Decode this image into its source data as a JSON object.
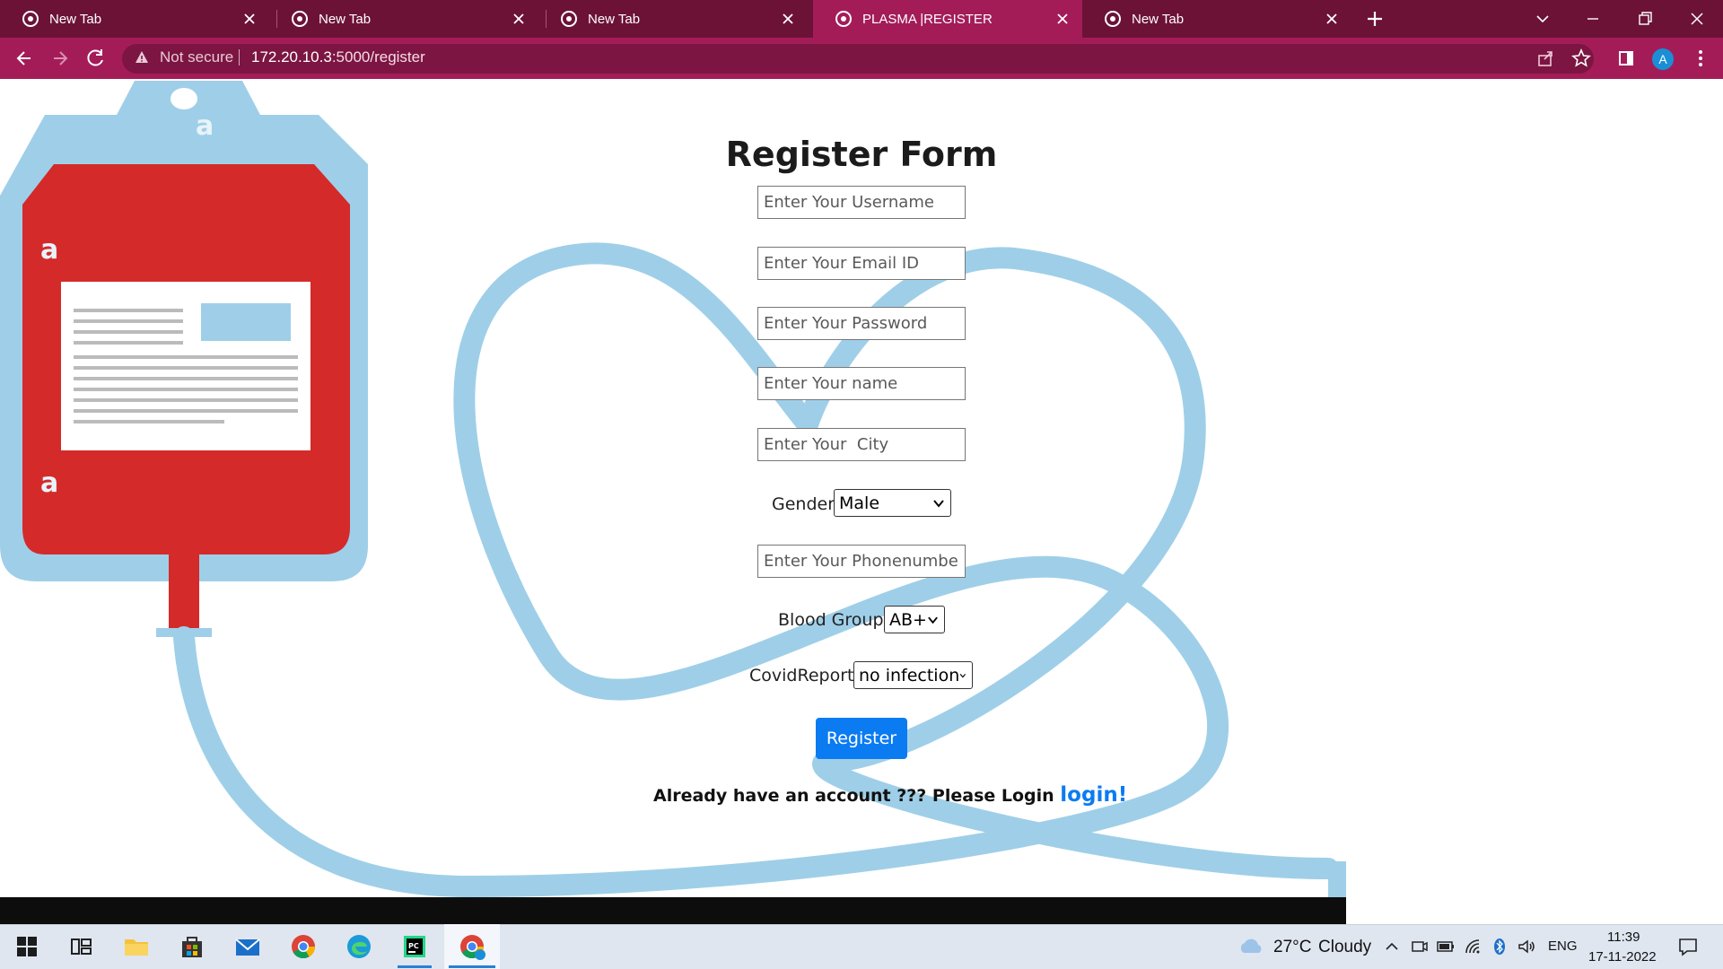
{
  "browser": {
    "tabs": [
      {
        "label": "New Tab",
        "favicon": "chrome-icon",
        "active": false
      },
      {
        "label": "New Tab",
        "favicon": "chrome-icon",
        "active": false
      },
      {
        "label": "New Tab",
        "favicon": "chrome-icon",
        "active": false
      },
      {
        "label": "PLASMA |REGISTER",
        "favicon": "globe-icon",
        "active": true
      },
      {
        "label": "New Tab",
        "favicon": "chrome-icon",
        "active": false
      }
    ],
    "security_label": "Not secure",
    "url_host": "172.20.10.3",
    "url_rest": ":5000/register",
    "profile_initial": "A",
    "theme": {
      "tabstrip": "#6c1237",
      "toolbar": "#a31c58",
      "omnibox": "#7c1542"
    }
  },
  "form": {
    "title": "Register Form",
    "username_placeholder": "Enter Your Username",
    "email_placeholder": "Enter Your Email ID",
    "password_placeholder": "Enter Your Password",
    "name_placeholder": "Enter Your name",
    "city_placeholder": "Enter Your  City",
    "gender_label": "Gender",
    "gender_value": "Male",
    "phone_placeholder": "Enter Your Phonenumber",
    "blood_group_label": "Blood Group",
    "blood_group_value": "AB+",
    "covid_label": "CovidReport",
    "covid_value": "no infection",
    "register_label": "Register",
    "login_prompt": "Already have an account ??? Please Login ",
    "login_link": "login!",
    "accent": "#0b7bf2"
  },
  "background": {
    "illustration": "blood-bag-heart-tube",
    "watermark_glyph": "a",
    "colors": {
      "bag": "#9fcfe8",
      "blood": "#d42a2a",
      "label": "#ffffff"
    }
  },
  "taskbar": {
    "apps": [
      "windows-start-icon",
      "task-view-icon",
      "file-explorer-icon",
      "store-icon",
      "mail-icon",
      "chrome-icon",
      "edge-icon",
      "pycharm-icon",
      "chrome-profile-icon"
    ],
    "weather_temp": "27°C",
    "weather_text": "Cloudy",
    "language": "ENG",
    "time": "11:39",
    "date": "17-11-2022"
  }
}
